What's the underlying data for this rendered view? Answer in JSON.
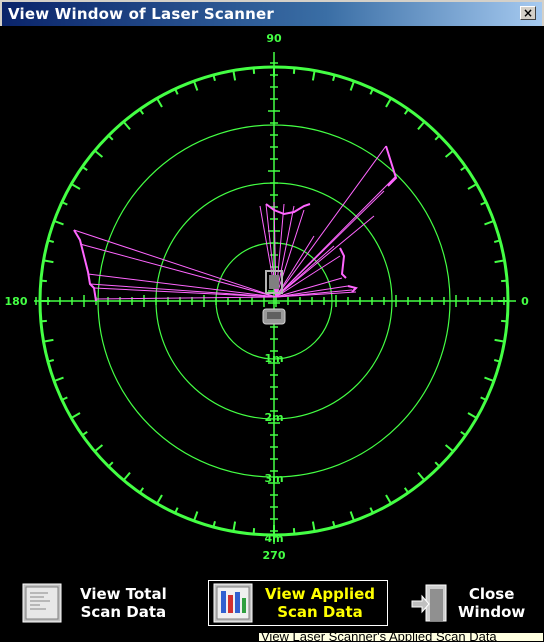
{
  "window": {
    "title": "View Window of Laser Scanner",
    "close_glyph": "×"
  },
  "scope": {
    "angle_labels": {
      "top": "90",
      "left": "180",
      "right": "0",
      "bottom": "270"
    },
    "range_labels": [
      "1m",
      "2m",
      "3m",
      "4m"
    ],
    "colors": {
      "grid": "#44ff44",
      "scan": "#ff66ff",
      "robot": "#b4b4b4"
    }
  },
  "toolbar": {
    "total_label": "View Total\nScan Data",
    "applied_label": "View Applied\nScan Data",
    "close_label": "Close\nWindow",
    "icons": [
      "document-icon",
      "chart-document-icon",
      "door-exit-icon"
    ]
  },
  "status": {
    "tooltip": "View Laser Scanner's Applied Scan Data"
  }
}
